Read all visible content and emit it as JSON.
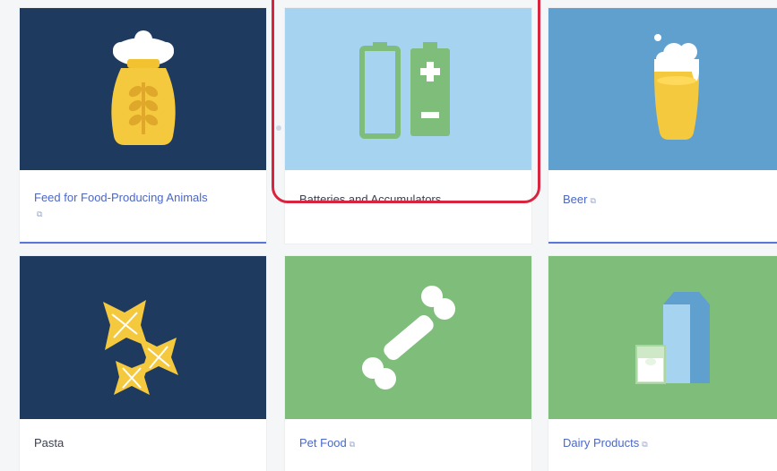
{
  "colors": {
    "navy": "#1f3a5f",
    "light_blue": "#a5d3f0",
    "mid_blue": "#5fa0cf",
    "green": "#7fbd7a",
    "link": "#4a67c9",
    "highlight": "#d8243e"
  },
  "cards": [
    {
      "label": "Feed for Food-Producing Animals",
      "icon": "feed-sack-icon",
      "has_external": true
    },
    {
      "label": "Batteries and Accumulators",
      "icon": "battery-icon",
      "has_external": false
    },
    {
      "label": "Beer",
      "icon": "beer-glass-icon",
      "has_external": true
    },
    {
      "label": "Pasta",
      "icon": "pasta-icon",
      "has_external": false
    },
    {
      "label": "Pet Food",
      "icon": "bone-icon",
      "has_external": true
    },
    {
      "label": "Dairy Products",
      "icon": "milk-carton-icon",
      "has_external": true
    }
  ],
  "external_glyph": "⧉"
}
